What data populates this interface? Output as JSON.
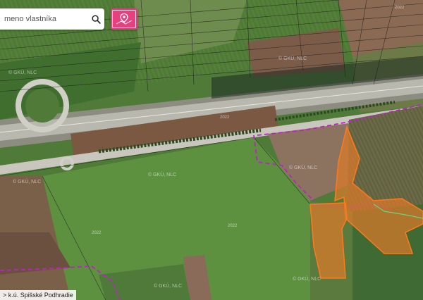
{
  "search": {
    "placeholder": "meno vlastníka"
  },
  "status": {
    "text": "> k.ú. Spišské Podhradie"
  },
  "watermarks": [
    "© GKÚ, NLC",
    "© GKÚ, NLC",
    "© GKÚ, NLC",
    "© GKÚ, NLC",
    "© GKÚ, NLC",
    "© GKÚ, NLC",
    "© GKÚ, NLC"
  ],
  "years": [
    "2022",
    "2022",
    "2022",
    "2022"
  ],
  "colors": {
    "accent": "#e6407e",
    "cadastral_boundary": "#c020c8",
    "selected_parcel_fill": "#e07a2a",
    "selected_parcel_outline": "#ff7a1a"
  },
  "icons": {
    "search": "search-icon",
    "locate": "map-pin-icon"
  }
}
